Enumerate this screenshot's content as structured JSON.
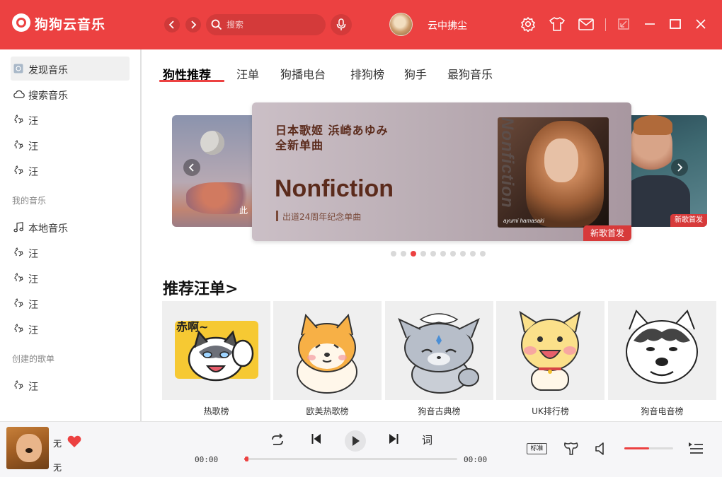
{
  "app": {
    "title": "狗狗云音乐"
  },
  "header": {
    "search_placeholder": "搜索",
    "username": "云中拂尘",
    "icons": [
      "back-icon",
      "forward-icon",
      "search-icon",
      "mic-icon",
      "settings-icon",
      "skin-icon",
      "mail-icon",
      "mini-mode-icon",
      "minimize-icon",
      "maximize-icon",
      "close-icon"
    ]
  },
  "sidebar": {
    "top_items": [
      {
        "label": "发现音乐",
        "icon": "discover-icon",
        "active": true
      },
      {
        "label": "搜索音乐",
        "icon": "cloud-icon"
      },
      {
        "label": "汪",
        "icon": "dog-icon"
      },
      {
        "label": "汪",
        "icon": "dog-icon"
      },
      {
        "label": "汪",
        "icon": "dog-icon"
      }
    ],
    "my_music_title": "我的音乐",
    "my_music_items": [
      {
        "label": "本地音乐",
        "icon": "music-note-icon"
      },
      {
        "label": "汪",
        "icon": "dog-icon"
      },
      {
        "label": "汪",
        "icon": "dog-icon"
      },
      {
        "label": "汪",
        "icon": "dog-icon"
      },
      {
        "label": "汪",
        "icon": "dog-icon"
      }
    ],
    "created_title": "创建的歌单",
    "created_items": [
      {
        "label": "汪",
        "icon": "dog-icon"
      }
    ]
  },
  "tabs": [
    {
      "label": "狗性推荐",
      "active": true
    },
    {
      "label": "汪单"
    },
    {
      "label": "狗播电台"
    },
    {
      "label": "排狗榜"
    },
    {
      "label": "狗手"
    },
    {
      "label": "最狗音乐"
    }
  ],
  "banner": {
    "line1": "日本歌姬 浜崎あゆみ",
    "line2": "全新单曲",
    "title": "Nonfiction",
    "subtitle": "出道24周年纪念单曲",
    "photo_vertical_text": "Nonfiction",
    "photo_caption": "ayumi hamasaki",
    "badge": "新歌首发",
    "left_text": "此",
    "right_badge": "新歌首发",
    "dot_count": 10,
    "active_dot": 2
  },
  "recommend": {
    "title": "推荐汪单",
    "cards": [
      {
        "label": "热歌榜",
        "sticker_text": "赤啊~"
      },
      {
        "label": "欧美热歌榜"
      },
      {
        "label": "狗音古典榜"
      },
      {
        "label": "UK排行榜"
      },
      {
        "label": "狗音电音榜"
      }
    ]
  },
  "player": {
    "song": "无",
    "artist": "无",
    "time_current": "00:00",
    "time_total": "00:00",
    "progress": 0.01,
    "lyric_label": "词",
    "quality_label": "标准",
    "volume": 0.5,
    "liked": true,
    "heart_color": "#ec4141"
  },
  "colors": {
    "accent": "#ec4141"
  }
}
